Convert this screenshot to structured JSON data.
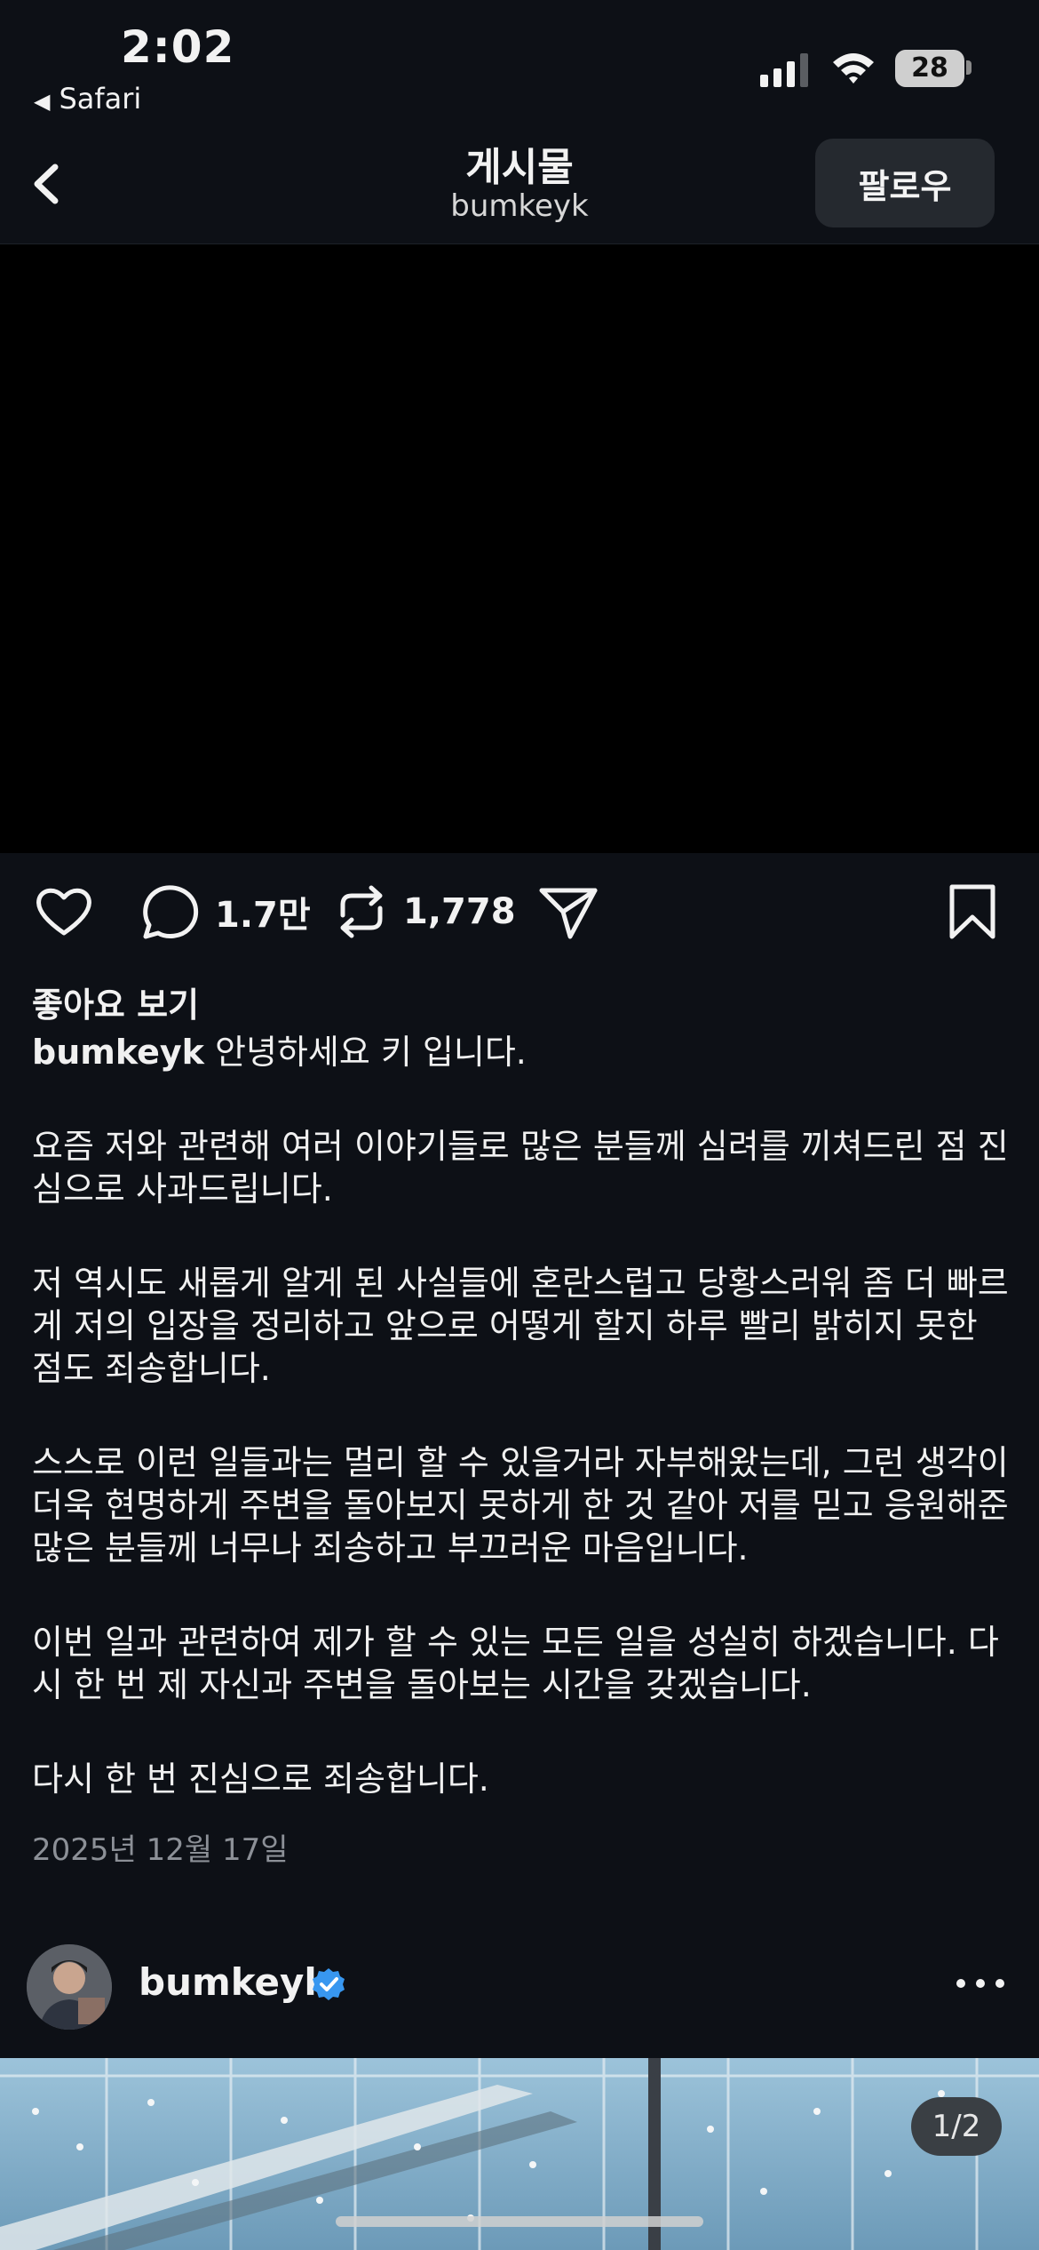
{
  "status_bar": {
    "time": "2:02",
    "back_app": "Safari",
    "battery": "28"
  },
  "nav": {
    "title": "게시물",
    "subtitle": "bumkeyk",
    "follow_label": "팔로우"
  },
  "actions": {
    "comments_count": "1.7만",
    "reposts_count": "1,778"
  },
  "post": {
    "likes_link": "좋아요 보기",
    "username": "bumkeyk",
    "first_line": " 안녕하세요 키 입니다.",
    "paragraphs": [
      "요즘 저와 관련해 여러 이야기들로 많은 분들께 심려를 끼쳐드린 점 진심으로 사과드립니다.",
      "저 역시도 새롭게 알게 된 사실들에 혼란스럽고 당황스러워 좀 더 빠르게 저의 입장을 정리하고 앞으로 어떻게 할지 하루 빨리 밝히지 못한 점도 죄송합니다.",
      "스스로 이런 일들과는 멀리 할 수 있을거라 자부해왔는데, 그런 생각이 더욱 현명하게 주변을 돌아보지 못하게 한 것 같아 저를 믿고 응원해준 많은 분들께 너무나 죄송하고 부끄러운 마음입니다.",
      "이번 일과 관련하여 제가 할 수 있는 모든 일을 성실히 하겠습니다. 다시 한 번 제 자신과 주변을 돌아보는 시간을 갖겠습니다.",
      "다시 한 번 진심으로 죄송합니다."
    ],
    "date": "2025년 12월 17일"
  },
  "next_post": {
    "username": "bumkeyk",
    "pager": "1/2"
  },
  "colors": {
    "background": "#0d1016",
    "media": "#000000",
    "verified": "#3897f0",
    "muted": "#8c9097"
  }
}
